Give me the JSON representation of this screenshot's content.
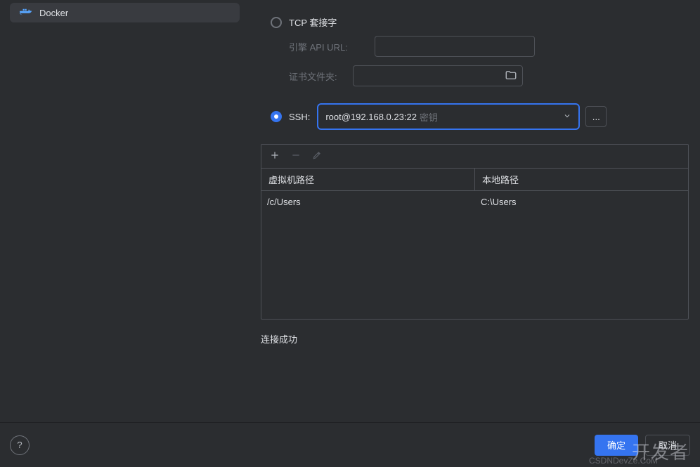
{
  "sidebar": {
    "items": [
      {
        "label": "Docker"
      }
    ]
  },
  "connection": {
    "tcp_label": "TCP 套接字",
    "engine_api_label": "引擎 API URL:",
    "engine_api_value": "",
    "cert_folder_label": "证书文件夹:",
    "cert_folder_value": "",
    "ssh_label": "SSH:",
    "ssh_host": "root@192.168.0.23:22",
    "ssh_auth": "密钥",
    "more_label": "..."
  },
  "path_table": {
    "headers": {
      "vm": "虚拟机路径",
      "local": "本地路径"
    },
    "rows": [
      {
        "vm": "/c/Users",
        "local": "C:\\Users"
      }
    ]
  },
  "status": "连接成功",
  "footer": {
    "ok": "确定",
    "cancel": "取消"
  },
  "watermark_main": "开发者",
  "watermark_sub": "CSDNDevZe.CoM"
}
